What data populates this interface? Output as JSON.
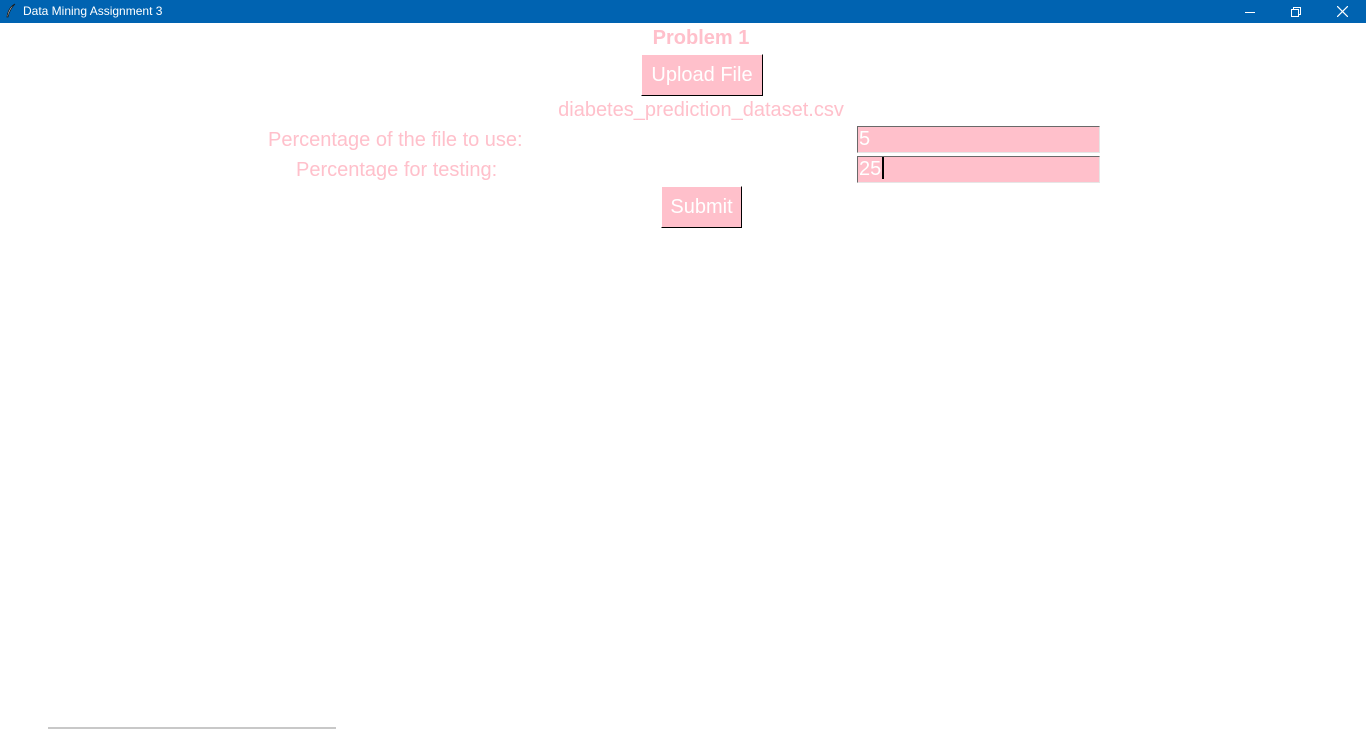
{
  "window": {
    "title": "Data Mining Assignment 3",
    "icon": "feather-icon",
    "controls": [
      "minimize-icon",
      "restore-icon",
      "close-icon"
    ]
  },
  "main": {
    "heading": "Problem 1",
    "upload_button_label": "Upload File",
    "selected_file": "diabetes_prediction_dataset.csv",
    "fields": {
      "file_percentage_label": "Percentage of the file to use:",
      "file_percentage_value": "5",
      "testing_percentage_label": "Percentage for testing:",
      "testing_percentage_value": "25"
    },
    "submit_button_label": "Submit"
  },
  "colors": {
    "titlebar": "#0063b1",
    "accent_pink": "#ffc0cb",
    "background": "#ffffff",
    "text_on_pink": "#ffffff"
  }
}
